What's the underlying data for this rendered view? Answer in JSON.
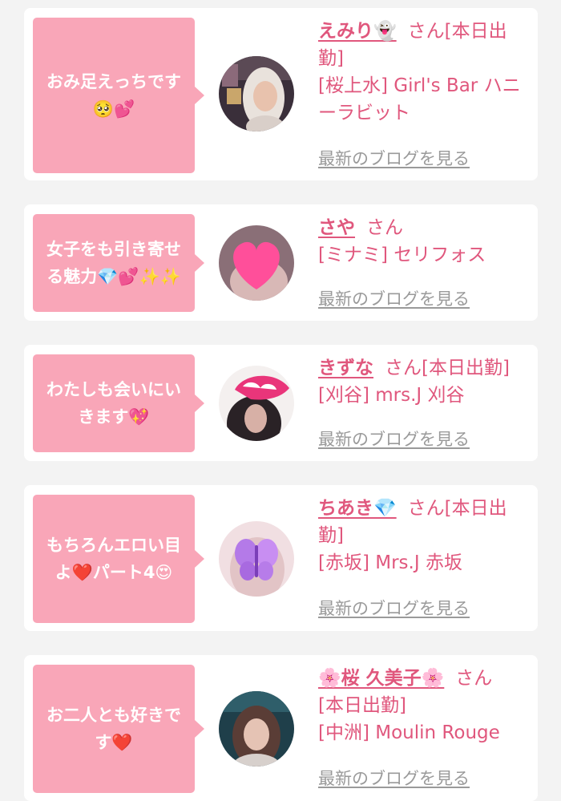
{
  "cards": [
    {
      "bubble": "おみ足えっちです🥺💕",
      "name": "えみり👻",
      "suffix": "さん[本日出勤]",
      "shop": "[桜上水] Girl's Bar ハニーラビット",
      "blog": "最新のブログを見る",
      "avatar_style": "photo-blonde"
    },
    {
      "bubble": "女子をも引き寄せる魅力💎💕✨✨",
      "name": "さや",
      "suffix": "さん",
      "shop": "[ミナミ] セリフォス",
      "blog": "最新のブログを見る",
      "avatar_style": "heart-sticker"
    },
    {
      "bubble": "わたしも会いにいきます💖",
      "name": "きずな",
      "suffix": "さん[本日出勤]",
      "shop": "[刈谷] mrs.J 刈谷",
      "blog": "最新のブログを見る",
      "avatar_style": "heart-sticker-dark"
    },
    {
      "bubble": "もちろんエロい目よ❤️パート4😍",
      "name": "ちあき💎",
      "suffix": "さん[本日出勤]",
      "shop": "[赤坂] Mrs.J 赤坂",
      "blog": "最新のブログを見る",
      "avatar_style": "butterfly-sticker"
    },
    {
      "bubble": "お二人とも好きです❤️",
      "name": "🌸桜 久美子🌸",
      "suffix": "さん",
      "status": "[本日出勤]",
      "shop": "[中洲] Moulin Rouge",
      "blog": "最新のブログを見る",
      "avatar_style": "photo-dark"
    }
  ],
  "colors": {
    "bubble": "#f9a6b8",
    "accent": "#e0577d",
    "link_gray": "#9a9a9a",
    "page_bg": "#f3f3f3"
  }
}
